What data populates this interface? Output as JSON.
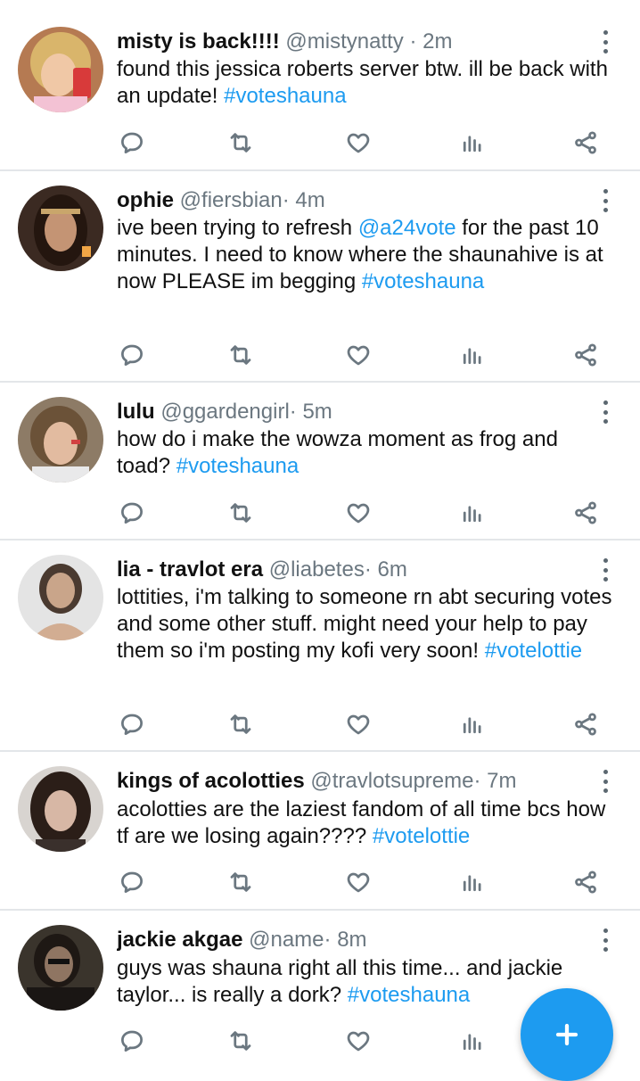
{
  "colors": {
    "accent": "#1d9bf0",
    "text": "#111111",
    "muted": "#6b7780",
    "divider": "#e3e6e9"
  },
  "tweets": [
    {
      "name": "misty is back!!!!",
      "handle": "@mistynatty",
      "time": "· 2m",
      "text": "found this jessica roberts server btw. ill be back with an update! ",
      "tags": [
        "#voteshauna"
      ]
    },
    {
      "name": "ophie",
      "handle": "@fiersbian",
      "time": "· 4m",
      "text_a": "ive been trying to refresh ",
      "mention": "@a24vote",
      "text_b": " for the past 10 minutes. I need to know where the shaunahive is at now PLEASE im begging ",
      "tags": [
        "#voteshauna"
      ]
    },
    {
      "name": "lulu",
      "handle": "@ggardengirl",
      "time": "· 5m",
      "text": "how do i make the wowza moment as frog and toad? ",
      "tags": [
        "#voteshauna"
      ]
    },
    {
      "name": "lia - travlot era",
      "handle": "@liabetes",
      "time": "· 6m",
      "text": "lottities, i'm talking to someone rn abt securing votes and some other stuff. might need your help to pay them so i'm posting my kofi very soon!  ",
      "tags": [
        "#votelottie"
      ]
    },
    {
      "name": "kings of acolotties",
      "handle": "@travlotsupreme",
      "time": "· 7m",
      "text": "acolotties are the laziest fandom of all time bcs how tf are we losing again???? ",
      "tags": [
        "#votelottie"
      ]
    },
    {
      "name": "jackie akgae",
      "handle": "@name",
      "time": "· 8m",
      "text": "guys was shauna right all this time... and jackie taylor... is really a dork? ",
      "tags": [
        "#voteshauna"
      ]
    }
  ],
  "icons": {
    "reply": "reply-icon",
    "retweet": "retweet-icon",
    "like": "heart-icon",
    "stats": "stats-icon",
    "share": "share-icon",
    "more": "more-vertical-icon",
    "compose": "plus-icon"
  }
}
